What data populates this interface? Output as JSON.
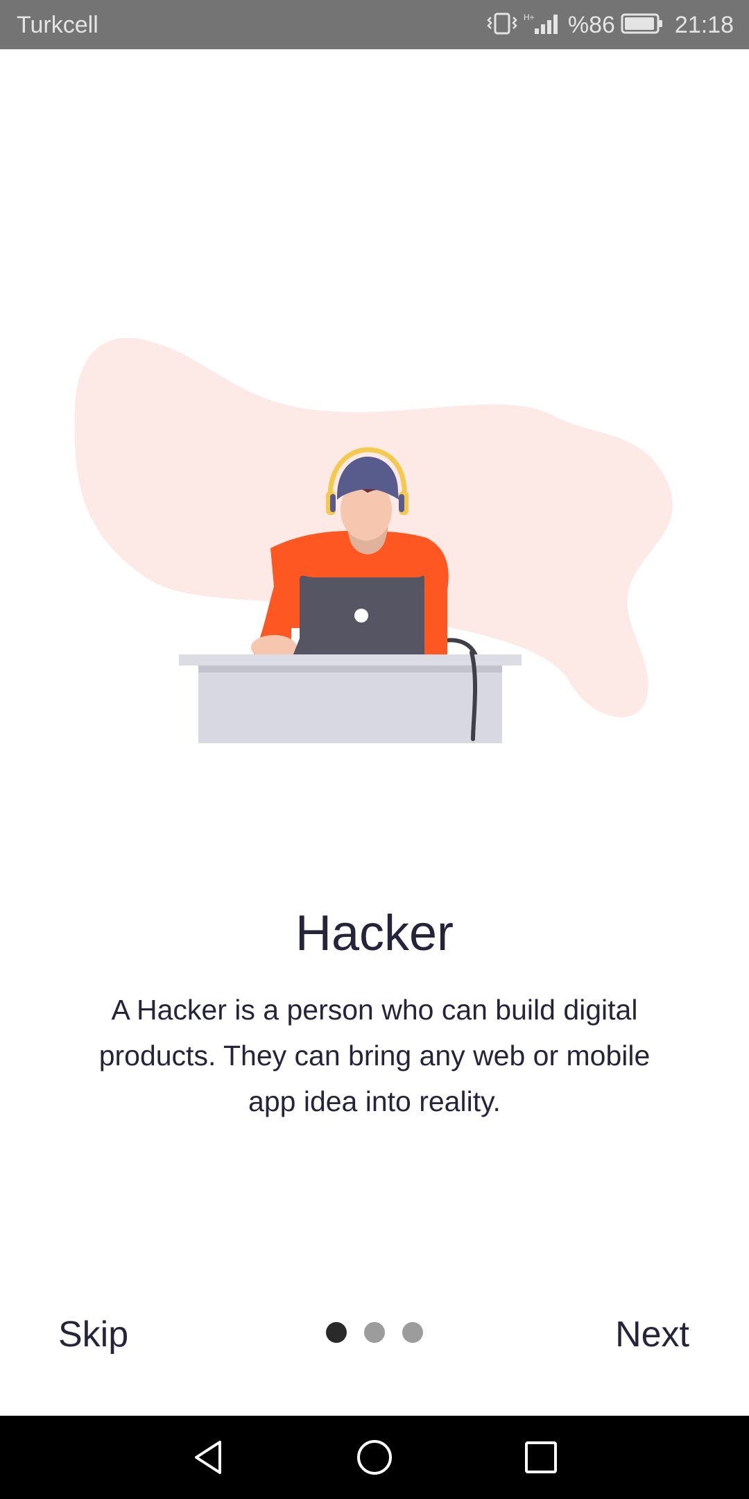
{
  "status_bar": {
    "carrier": "Turkcell",
    "battery_percent": "%86",
    "time": "21:18",
    "icons": [
      "vibrate-icon",
      "signal-icon",
      "battery-icon"
    ]
  },
  "onboarding": {
    "illustration": "hacker-at-laptop-illustration",
    "title": "Hacker",
    "description": "A Hacker is a person who can build digital products. They can bring any web or mobile app idea into reality.",
    "page_index": 1,
    "page_count": 3
  },
  "controls": {
    "skip_label": "Skip",
    "next_label": "Next"
  },
  "nav_bar": {
    "icons": [
      "back-icon",
      "home-icon",
      "recent-apps-icon"
    ]
  },
  "colors": {
    "status_bar": "#747474",
    "blob": "#fdeae7",
    "shirt": "#ff5722",
    "laptop": "#555563",
    "desk": "#d8d8e2",
    "cap": "#585c8c",
    "headphones": "#f5c94b",
    "text": "#26243a",
    "dot_active": "#2a2a2a",
    "dot_inactive": "#9c9c9c"
  }
}
